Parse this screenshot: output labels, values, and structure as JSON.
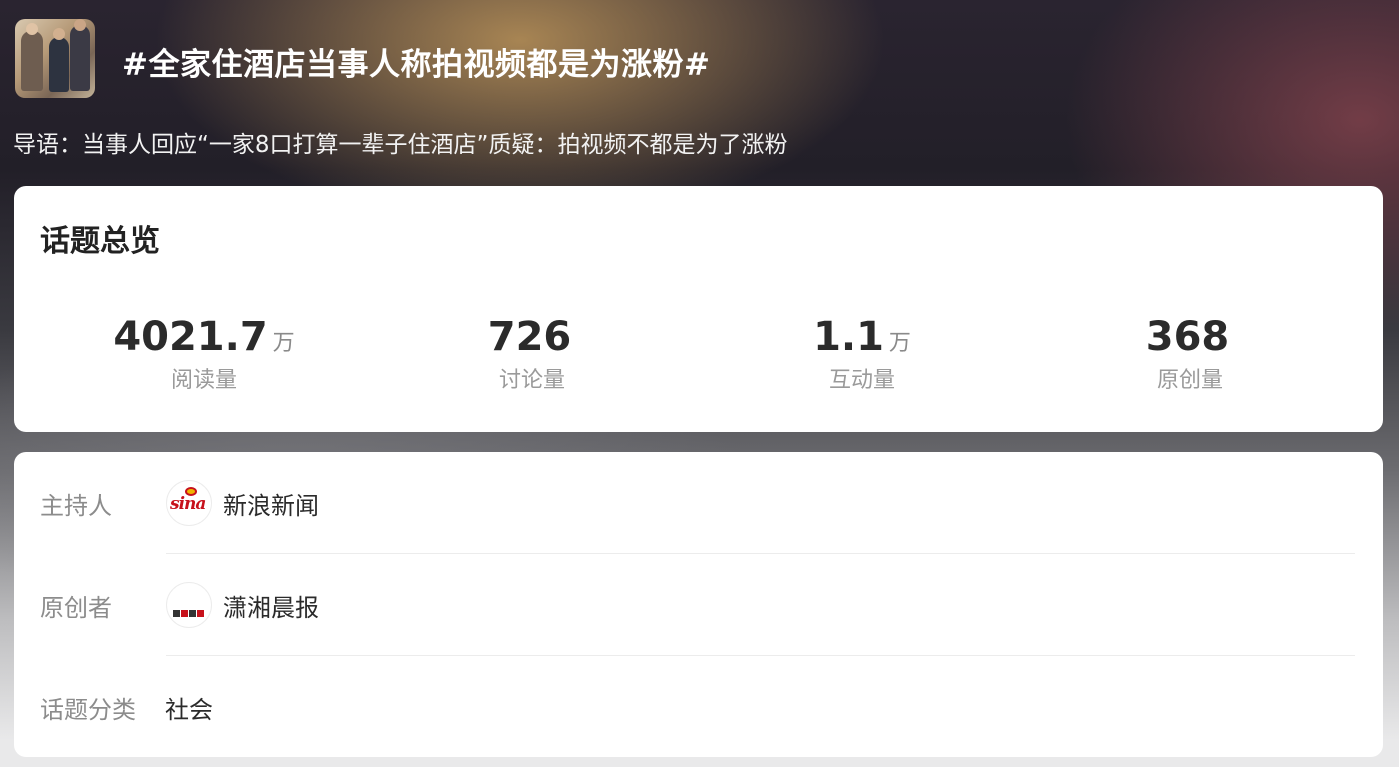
{
  "header": {
    "topic_thumbnail": "topic-photo-family",
    "title": "#全家住酒店当事人称拍视频都是为涨粉#",
    "intro": "导语：当事人回应“一家8口打算一辈子住酒店”质疑：拍视频不都是为了涨粉"
  },
  "overview": {
    "title": "话题总览",
    "stats": [
      {
        "value": "4021.7",
        "unit": "万",
        "label": "阅读量"
      },
      {
        "value": "726",
        "unit": "",
        "label": "讨论量"
      },
      {
        "value": "1.1",
        "unit": "万",
        "label": "互动量"
      },
      {
        "value": "368",
        "unit": "",
        "label": "原创量"
      }
    ]
  },
  "info": {
    "host": {
      "label": "主持人",
      "name": "新浪新闻",
      "avatar": "sina-logo",
      "logo_text": "sina"
    },
    "creator": {
      "label": "原创者",
      "name": "潇湘晨报",
      "avatar": "newspaper-logo"
    },
    "category": {
      "label": "话题分类",
      "value": "社会"
    }
  },
  "colors": {
    "header_text": "#ffffff",
    "stat_value": "#2b2b2b",
    "label_gray": "#8c8c8c",
    "sina_red": "#c7111b"
  }
}
